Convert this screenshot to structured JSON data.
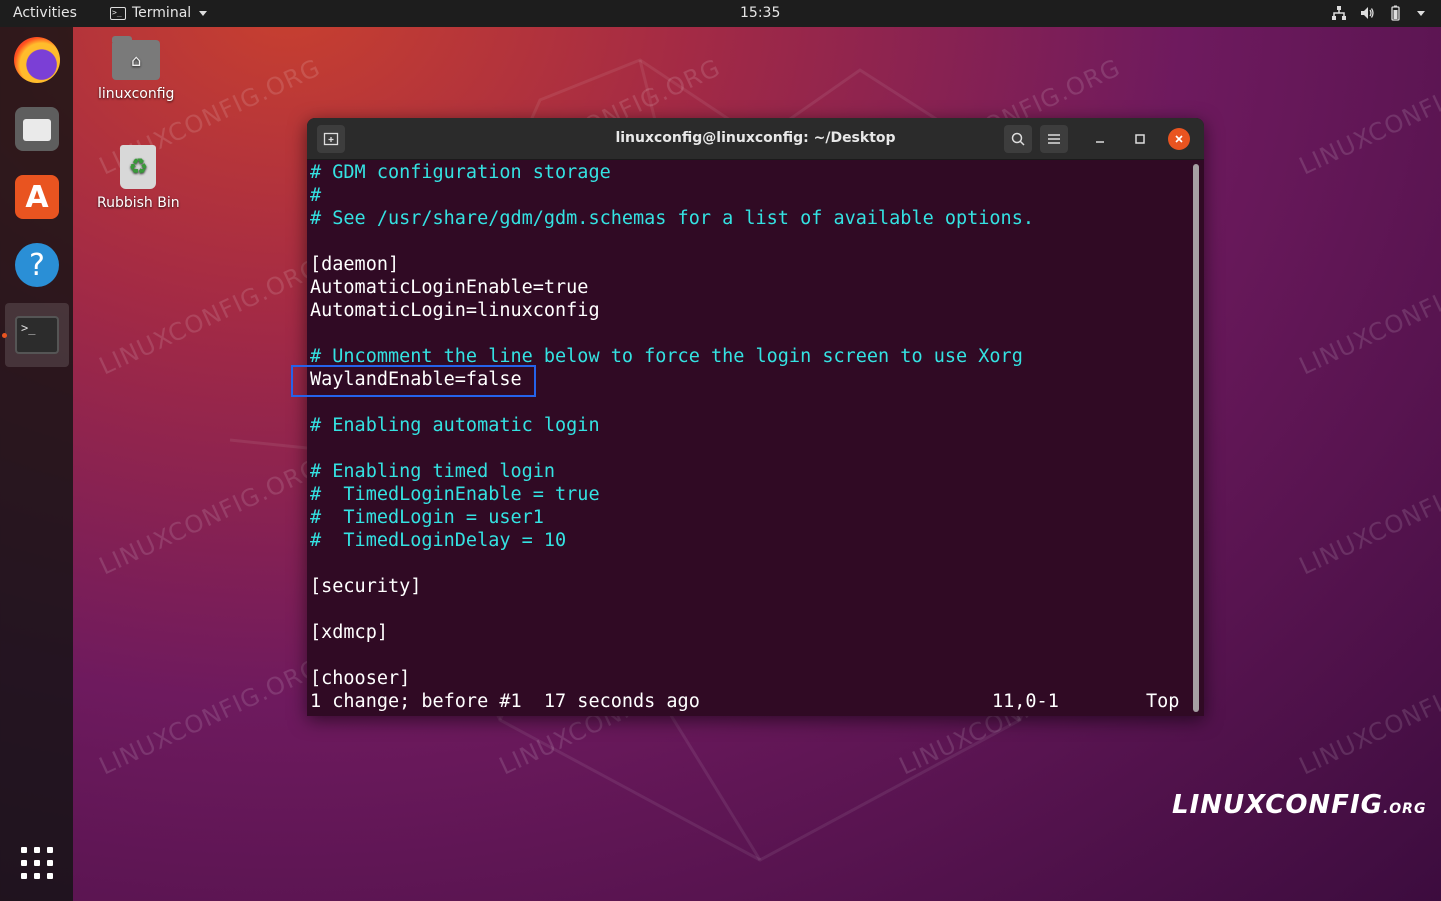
{
  "topbar": {
    "activities": "Activities",
    "app_name": "Terminal",
    "clock": "15:35"
  },
  "desktop": {
    "home_label": "linuxconfig",
    "bin_label": "Rubbish Bin"
  },
  "window": {
    "title": "linuxconfig@linuxconfig: ~/Desktop"
  },
  "terminal": {
    "lines": [
      {
        "text": "# GDM configuration storage",
        "type": "comment"
      },
      {
        "text": "#",
        "type": "comment"
      },
      {
        "text": "# See /usr/share/gdm/gdm.schemas for a list of available options.",
        "type": "comment"
      },
      {
        "text": "",
        "type": "plain"
      },
      {
        "text": "[daemon]",
        "type": "plain"
      },
      {
        "text": "AutomaticLoginEnable=true",
        "type": "plain"
      },
      {
        "text": "AutomaticLogin=linuxconfig",
        "type": "plain"
      },
      {
        "text": "",
        "type": "plain"
      },
      {
        "text": "# Uncomment the line below to force the login screen to use Xorg",
        "type": "comment"
      },
      {
        "text": "WaylandEnable=false",
        "type": "plain"
      },
      {
        "text": "",
        "type": "plain"
      },
      {
        "text": "# Enabling automatic login",
        "type": "comment"
      },
      {
        "text": "",
        "type": "plain"
      },
      {
        "text": "# Enabling timed login",
        "type": "comment"
      },
      {
        "text": "#  TimedLoginEnable = true",
        "type": "comment"
      },
      {
        "text": "#  TimedLogin = user1",
        "type": "comment"
      },
      {
        "text": "#  TimedLoginDelay = 10",
        "type": "comment"
      },
      {
        "text": "",
        "type": "plain"
      },
      {
        "text": "[security]",
        "type": "plain"
      },
      {
        "text": "",
        "type": "plain"
      },
      {
        "text": "[xdmcp]",
        "type": "plain"
      },
      {
        "text": "",
        "type": "plain"
      },
      {
        "text": "[chooser]",
        "type": "plain"
      }
    ],
    "status_message": "1 change; before #1  17 seconds ago",
    "status_position": "11,0-1",
    "status_scroll": "Top"
  },
  "watermark": "LINUXCONFIG.ORG",
  "brand": {
    "part1": "LINUX",
    "part2": "CONFIG",
    "part3": ".ORG"
  },
  "colors": {
    "terminal_bg": "#300a24",
    "comment": "#34e2e2",
    "accent": "#e95420",
    "highlight_box": "#2563eb"
  }
}
